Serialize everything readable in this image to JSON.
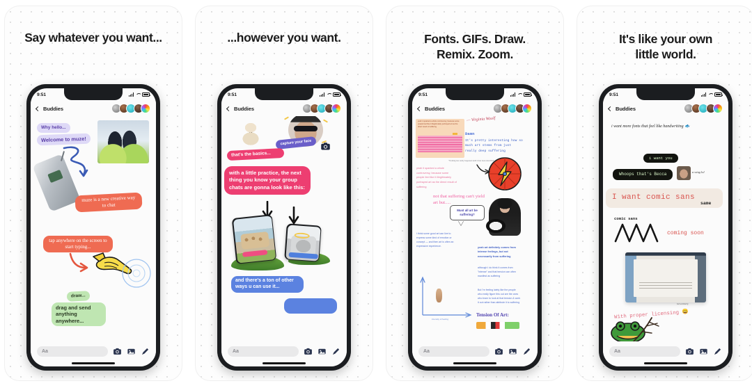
{
  "gallery": {
    "app_name": "muze",
    "panel_count": 4
  },
  "colors": {
    "bg": "#ffffff",
    "card_bg": "#fdfdfd",
    "dot": "#d8d8d8",
    "phone_bezel": "#1b1d20",
    "screen": "#fbfbfb",
    "lavender": "#ded9f7",
    "lavender_text": "#5a3fa8",
    "red": "#ef6b52",
    "green": "#bfe6b2",
    "pink": "#ed3e71",
    "blue": "#5b82e0",
    "purple": "#6a5ec9",
    "black_bubble": "#12140f",
    "cream": "#f2eae2",
    "comic_red": "#d9544f",
    "heading": "#1b1b1b"
  },
  "status_bar": {
    "time": "9:51",
    "icons": [
      "signal-bars-icon",
      "wifi-icon",
      "battery-icon"
    ]
  },
  "chat_header": {
    "back_icon": "back-chevron-icon",
    "title": "Buddies",
    "avatars": [
      {
        "name": "avatar-1",
        "color": "#8e8e8e"
      },
      {
        "name": "avatar-2",
        "color": "#6d4a33"
      },
      {
        "name": "avatar-3",
        "color": "#3fc4cf"
      },
      {
        "name": "avatar-4",
        "color": "#4a342a"
      },
      {
        "name": "avatar-5",
        "color": "rainbow"
      }
    ]
  },
  "composer": {
    "text_placeholder": "Aa",
    "icons": [
      "camera-icon",
      "photo-icon",
      "pencil-icon"
    ]
  },
  "panels": [
    {
      "id": "panel-1",
      "heading": "Say whatever you want...",
      "bubbles": [
        {
          "name": "bubble-why-hello",
          "text": "Why hello...",
          "style": "lavender"
        },
        {
          "name": "bubble-welcome",
          "text": "Welcome to muze!",
          "style": "lavender"
        },
        {
          "name": "bubble-muze-is-new",
          "text": "muze is a new creative way to chat",
          "style": "red"
        },
        {
          "name": "bubble-tap-anywhere",
          "text": "tap anywhere on the screen to start typing...",
          "style": "red"
        },
        {
          "name": "bubble-draw",
          "text": "draw...",
          "style": "green"
        },
        {
          "name": "bubble-drag-and-send",
          "text": "drag and send anything anywhere...",
          "style": "green"
        }
      ],
      "art": [
        {
          "name": "penguins-sticker",
          "kind": "photo"
        },
        {
          "name": "flip-phone-sticker",
          "kind": "photo"
        },
        {
          "name": "pointing-hand-sticker",
          "kind": "illustration"
        },
        {
          "name": "blue-squiggle-arrow",
          "kind": "scribble"
        },
        {
          "name": "red-curved-arrow",
          "kind": "scribble"
        },
        {
          "name": "blue-tap-ripple",
          "kind": "scribble"
        }
      ]
    },
    {
      "id": "panel-2",
      "heading": "...however you want.",
      "bubbles": [
        {
          "name": "bubble-thats-the-basics",
          "text": "that's the basics...",
          "style": "pink"
        },
        {
          "name": "bubble-with-a-little-practice",
          "text": "with a little practice, the next thing you know your group chats are gonna look like this:",
          "style": "pink"
        },
        {
          "name": "bubble-capture-your-face",
          "text": "capture your face",
          "style": "purple"
        },
        {
          "name": "bubble-ton-of-other-ways",
          "text": "and there's a ton of other ways u can use it...",
          "style": "blue"
        }
      ],
      "art": [
        {
          "name": "puppy-sticker",
          "kind": "photo"
        },
        {
          "name": "selfie-sunglasses-sticker",
          "kind": "photo"
        },
        {
          "name": "camera-sticker-icon",
          "kind": "icon"
        },
        {
          "name": "black-down-arrow-left",
          "kind": "scribble"
        },
        {
          "name": "black-down-arrow-right",
          "kind": "scribble"
        },
        {
          "name": "mini-phone-eggs",
          "kind": "nested-phone"
        },
        {
          "name": "mini-phone-cat",
          "kind": "nested-phone"
        }
      ]
    },
    {
      "id": "panel-3",
      "heading": "Fonts. GIFs. Draw.\nRemix. Zoom.",
      "heading_lines": [
        "Fonts. GIFs. Draw.",
        "Remix. Zoom."
      ],
      "texts": [
        {
          "name": "quote-attribution",
          "text": "— Virginia Woolf",
          "style": "handwriting-red"
        },
        {
          "name": "sender-name-damn",
          "text": "Damn",
          "style": "mono-blue"
        },
        {
          "name": "msg-pretty-interesting",
          "text": "It's pretty interesting how so much art stems from just really deep suffering",
          "style": "mono-blue"
        },
        {
          "name": "msg-nothing-not-to-be-written",
          "text": "\"Nothing has really happened until it has been described\"",
          "style": "tiny-gray"
        },
        {
          "name": "msg-sparked-controversy",
          "text": "yeah it sparked a whole controversy, because some people feel like it illegitimately portrayed art as the direct result of suffering",
          "style": "tiny-pink"
        },
        {
          "name": "msg-not-that-suffering",
          "text": "not that suffering can't yield art but.....",
          "style": "pink-script"
        },
        {
          "name": "bubble-must-all-art-be-suffering",
          "text": "Must all art be suffering?",
          "style": "speech-balloon"
        },
        {
          "name": "msg-i-think-some-good-art",
          "text": "I think some good art can live to express some kind of emotion or concept — and then art is often an expressive experience.",
          "style": "tiny-blue"
        },
        {
          "name": "msg-yeah-art-definitely",
          "text": "yeah art definitely comes from intense feelings, but not necessarily from suffering",
          "style": "tiny-blue"
        },
        {
          "name": "msg-although",
          "text": "although I do think it comes from \"intense\" and that tension can often manifest as suffering",
          "style": "tiny-blue"
        },
        {
          "name": "msg-but-im-feeling",
          "text": "But I'm feeling lately like the people who really figure this out are the ones who learn to look at that tension & work it out rather than attribute it to suffering",
          "style": "tiny-blue"
        },
        {
          "name": "chart-title-tension-of-art",
          "text": "Tension Of Art:",
          "style": "serif-purple"
        },
        {
          "name": "axis-label-intensity",
          "text": "intensity of feeling",
          "style": "tiny-blue"
        }
      ],
      "art": [
        {
          "name": "orange-peach-sticker",
          "kind": "photo"
        },
        {
          "name": "red-circle-lightning-sticker",
          "kind": "illustration"
        },
        {
          "name": "person-cutout-sticker",
          "kind": "photo"
        },
        {
          "name": "peach-highlight-block",
          "kind": "highlight"
        },
        {
          "name": "pink-highlight-block",
          "kind": "highlight"
        },
        {
          "name": "blue-axis-arrows",
          "kind": "scribble"
        },
        {
          "name": "tiny-figure-sticker",
          "kind": "photo"
        },
        {
          "name": "color-swatch-strip",
          "kind": "illustration"
        }
      ]
    },
    {
      "id": "panel-4",
      "heading": "It's like your own\nlittle world.",
      "heading_lines": [
        "It's like your own",
        "little world."
      ],
      "texts": [
        {
          "name": "msg-handwriting-fonts",
          "text": "i want more fonts that feel like handwriting 🐟",
          "style": "script"
        },
        {
          "name": "bubble-i-want-you",
          "text": "i want you",
          "style": "terminal"
        },
        {
          "name": "bubble-whoops-becca",
          "text": "Whoops that's Becca",
          "style": "terminal"
        },
        {
          "name": "note-a-wing-lol",
          "text": "a wing lol",
          "style": "script-small"
        },
        {
          "name": "bubble-i-want-comic-sans",
          "text": "I want comic sans",
          "style": "comic-cream"
        },
        {
          "name": "tag-same",
          "text": "same",
          "style": "comic-small"
        },
        {
          "name": "label-comic-sans",
          "text": "comic sans",
          "style": "mono-dark"
        },
        {
          "name": "label-coming-soon",
          "text": "coming soon",
          "style": "comic-red"
        },
        {
          "name": "caption-lol-so-blurry",
          "text": "lol so blurry",
          "style": "script-tiny"
        },
        {
          "name": "msg-with-proper-licensing",
          "text": "With proper licensing 😄",
          "style": "comic-red"
        }
      ],
      "art": [
        {
          "name": "becca-face-sticker",
          "kind": "photo"
        },
        {
          "name": "laptop-photo",
          "kind": "photo"
        },
        {
          "name": "zigzag-scribble",
          "kind": "scribble"
        },
        {
          "name": "green-frog-sticker",
          "kind": "illustration"
        },
        {
          "name": "twig-branch-sticker",
          "kind": "illustration"
        }
      ]
    }
  ]
}
